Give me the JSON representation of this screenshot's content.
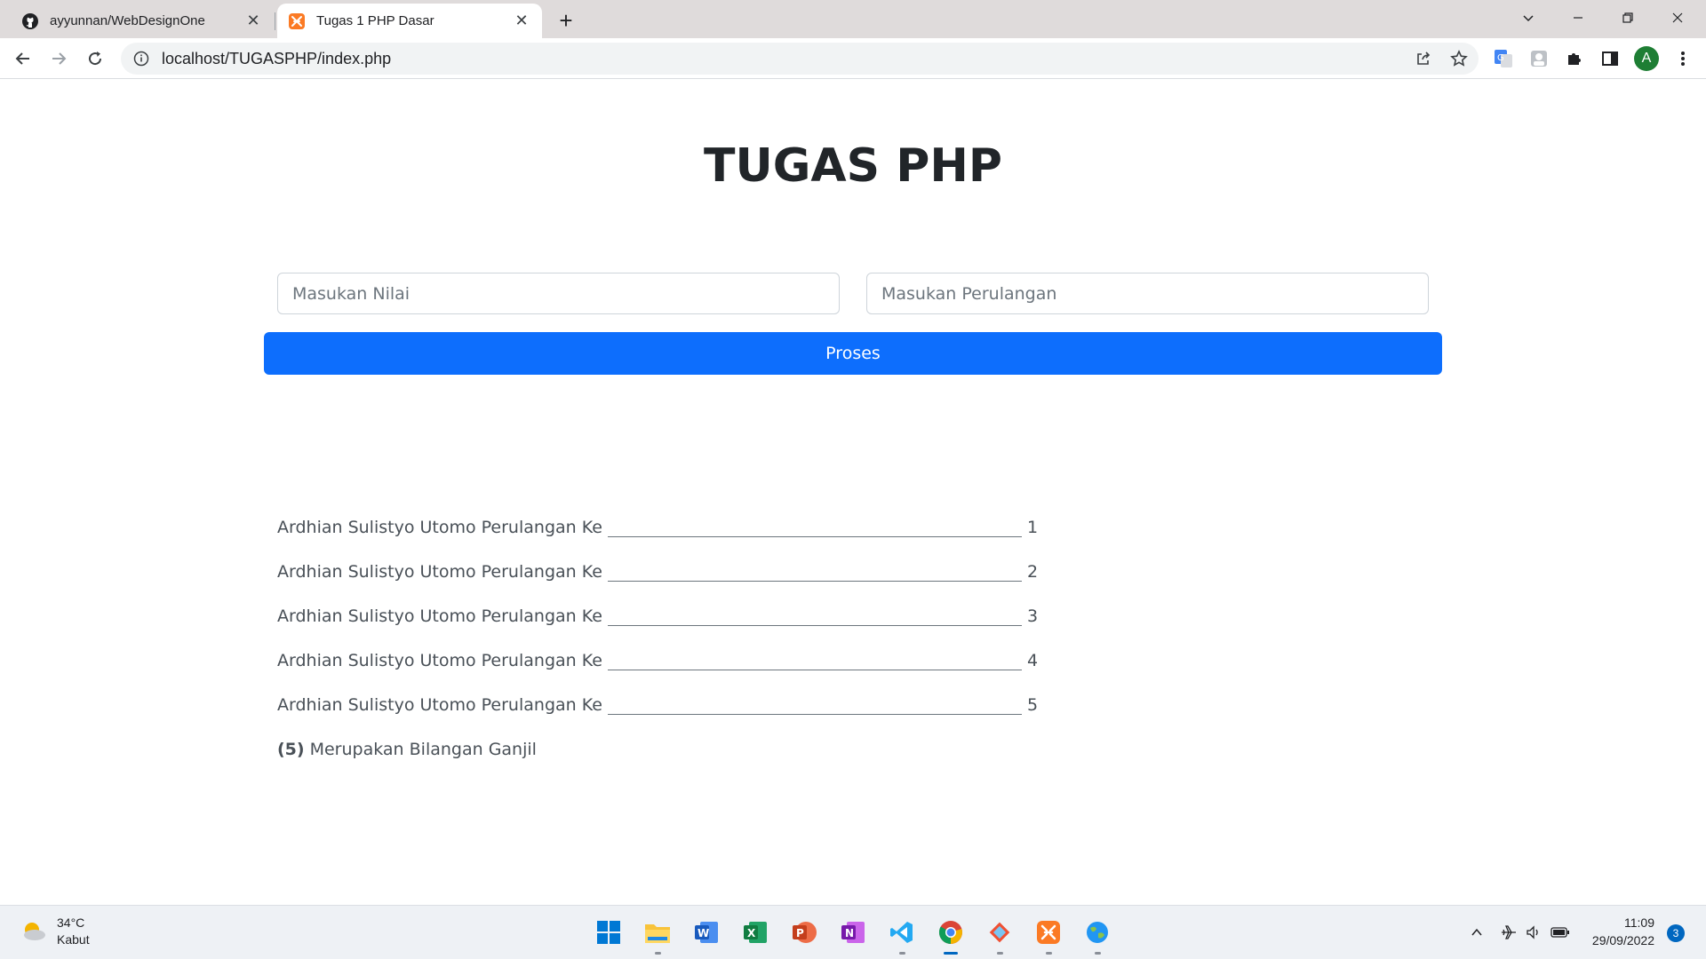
{
  "browser": {
    "tabs": [
      {
        "title": "ayyunnan/WebDesignOne",
        "icon": "github-icon",
        "active": false
      },
      {
        "title": "Tugas 1 PHP Dasar",
        "icon": "xampp-icon",
        "active": true
      }
    ],
    "new_tab_label": "+",
    "url": "localhost/TUGASPHP/index.php",
    "profile_initial": "A"
  },
  "page": {
    "title": "TUGAS PHP",
    "form": {
      "nilai_placeholder": "Masukan Nilai",
      "nilai_value": "",
      "perulangan_placeholder": "Masukan Perulangan",
      "perulangan_value": "",
      "submit_label": "Proses"
    },
    "results": [
      {
        "text": "Ardhian Sulistyo Utomo Perulangan Ke",
        "number": "1"
      },
      {
        "text": "Ardhian Sulistyo Utomo Perulangan Ke",
        "number": "2"
      },
      {
        "text": "Ardhian Sulistyo Utomo Perulangan Ke",
        "number": "3"
      },
      {
        "text": "Ardhian Sulistyo Utomo Perulangan Ke",
        "number": "4"
      },
      {
        "text": "Ardhian Sulistyo Utomo Perulangan Ke",
        "number": "5"
      }
    ],
    "summary": {
      "value": "(5)",
      "text": "Merupakan Bilangan Ganjil"
    }
  },
  "taskbar": {
    "weather": {
      "temp": "34°C",
      "condition": "Kabut"
    },
    "apps": [
      "windows-start-icon",
      "file-explorer-icon",
      "word-icon",
      "excel-icon",
      "powerpoint-icon",
      "onenote-icon",
      "vscode-icon",
      "chrome-icon",
      "git-icon",
      "xampp-icon",
      "earth-icon"
    ],
    "time": "11:09",
    "date": "29/09/2022",
    "notifications": "3"
  },
  "colors": {
    "primary_button": "#0d6efd",
    "tab_strip": "#dfdbdb",
    "taskbar": "#eef1f5"
  }
}
